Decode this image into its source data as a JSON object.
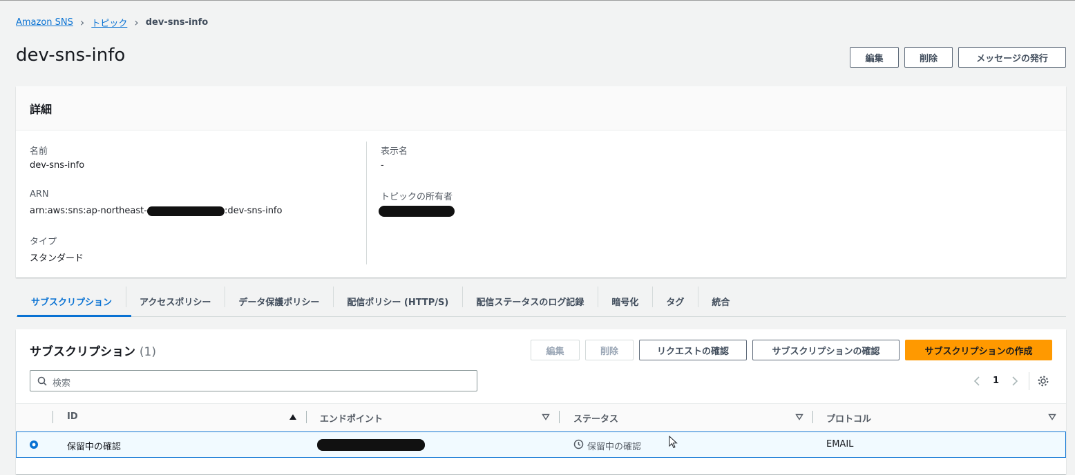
{
  "breadcrumb": {
    "root": "Amazon SNS",
    "topics": "トピック",
    "current": "dev-sns-info"
  },
  "page": {
    "title": "dev-sns-info"
  },
  "header_actions": {
    "edit": "編集",
    "delete": "削除",
    "publish": "メッセージの発行"
  },
  "details": {
    "title": "詳細",
    "name_label": "名前",
    "name_value": "dev-sns-info",
    "arn_label": "ARN",
    "arn_prefix": "arn:aws:sns:ap-northeast-",
    "arn_suffix": ":dev-sns-info",
    "type_label": "タイプ",
    "type_value": "スタンダード",
    "display_name_label": "表示名",
    "display_name_value": "-",
    "owner_label": "トピックの所有者"
  },
  "tabs": [
    "サブスクリプション",
    "アクセスポリシー",
    "データ保護ポリシー",
    "配信ポリシー (HTTP/S)",
    "配信ステータスのログ記録",
    "暗号化",
    "タグ",
    "統合"
  ],
  "subscriptions": {
    "title": "サブスクリプション",
    "count": "(1)",
    "edit": "編集",
    "delete": "削除",
    "request_confirm": "リクエストの確認",
    "confirm": "サブスクリプションの確認",
    "create": "サブスクリプションの作成",
    "search_placeholder": "検索",
    "page": "1",
    "columns": [
      "ID",
      "エンドポイント",
      "ステータス",
      "プロトコル"
    ],
    "rows": [
      {
        "id": "保留中の確認",
        "status": "保留中の確認",
        "protocol": "EMAIL"
      }
    ]
  }
}
